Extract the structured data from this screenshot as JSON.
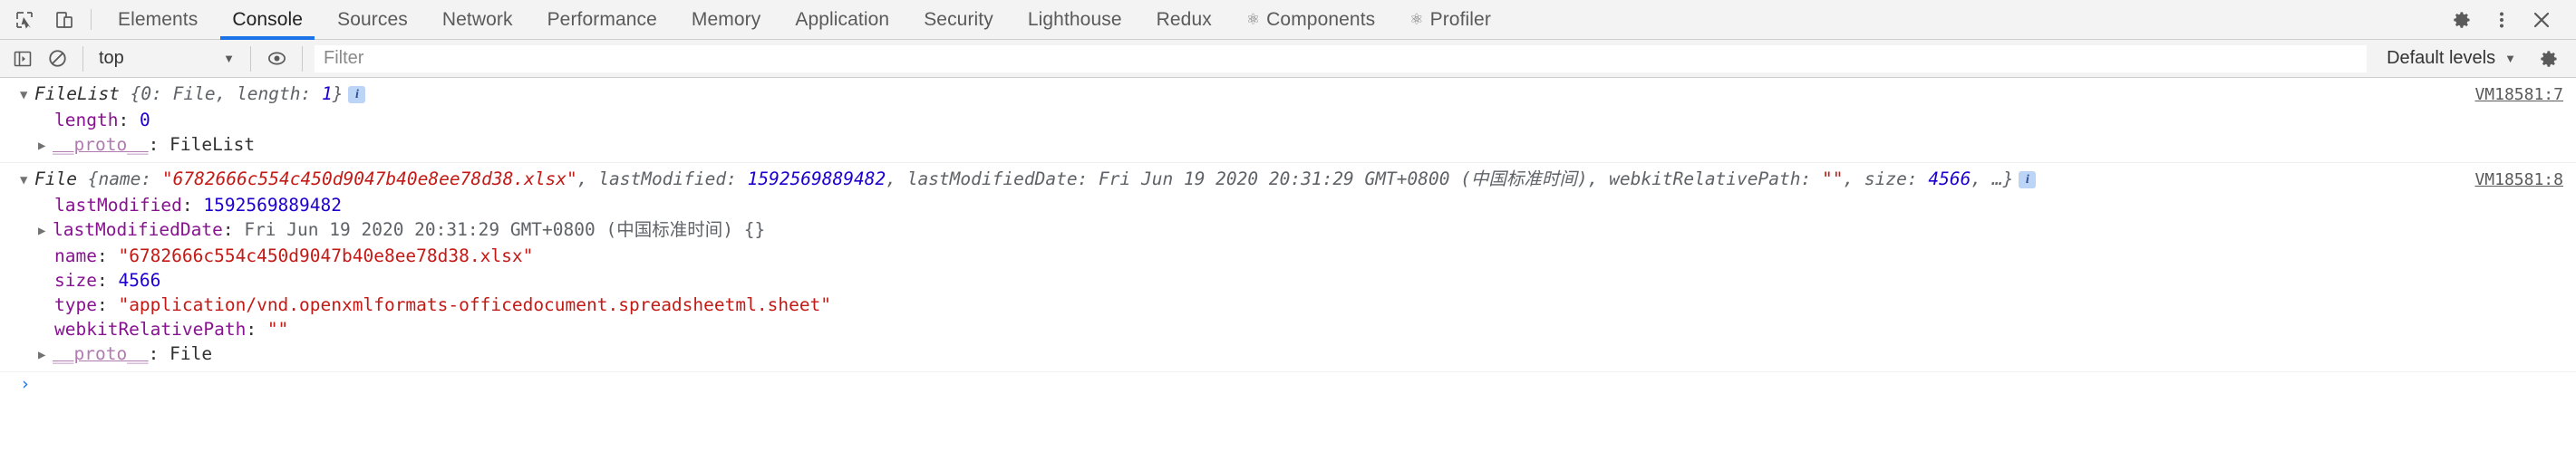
{
  "tabbar": {
    "left_icons": [
      {
        "name": "inspect-element-icon",
        "title": "Inspect element"
      },
      {
        "name": "device-toolbar-icon",
        "title": "Toggle device toolbar"
      }
    ],
    "tabs": [
      {
        "label": "Elements",
        "active": false,
        "icon": ""
      },
      {
        "label": "Console",
        "active": true,
        "icon": ""
      },
      {
        "label": "Sources",
        "active": false,
        "icon": ""
      },
      {
        "label": "Network",
        "active": false,
        "icon": ""
      },
      {
        "label": "Performance",
        "active": false,
        "icon": ""
      },
      {
        "label": "Memory",
        "active": false,
        "icon": ""
      },
      {
        "label": "Application",
        "active": false,
        "icon": ""
      },
      {
        "label": "Security",
        "active": false,
        "icon": ""
      },
      {
        "label": "Lighthouse",
        "active": false,
        "icon": ""
      },
      {
        "label": "Redux",
        "active": false,
        "icon": ""
      },
      {
        "label": "Components",
        "active": false,
        "icon": "⚛"
      },
      {
        "label": "Profiler",
        "active": false,
        "icon": "⚛"
      }
    ],
    "right_icons": [
      {
        "name": "settings-gear-icon"
      },
      {
        "name": "more-options-icon"
      },
      {
        "name": "close-devtools-icon"
      }
    ],
    "accent_color": "#1a73e8"
  },
  "console_toolbar": {
    "sidebar_toggle": "sidebar-toggle-icon",
    "clear_console": "clear-console-icon",
    "context_value": "top",
    "context_caret": "▼",
    "eye_icon": "live-expression-icon",
    "filter_placeholder": "Filter",
    "filter_value": "",
    "levels_label": "Default levels",
    "levels_caret": "▼",
    "settings_icon": "console-settings-icon"
  },
  "console": {
    "messages": [
      {
        "source": "VM18581:7",
        "header": {
          "toggle": "▼",
          "class_name": "FileList",
          "preview": " {0: File, length: 1}",
          "preview_parts": [
            {
              "t": " {0: File, length: ",
              "c": "preview"
            },
            {
              "t": "1",
              "c": "num"
            },
            {
              "t": "}",
              "c": "preview"
            }
          ],
          "info_badge": "i"
        },
        "props": [
          {
            "toggle": "",
            "key": "length",
            "sep": ": ",
            "value": "0",
            "value_class": "num"
          },
          {
            "toggle": "▶",
            "key": "__proto__",
            "sep": ": ",
            "value": "FileList",
            "value_class": "plain"
          }
        ]
      },
      {
        "source": "VM18581:8",
        "header": {
          "toggle": "▼",
          "class_name": "File",
          "preview_parts": [
            {
              "t": " {name: ",
              "c": "preview"
            },
            {
              "t": "\"6782666c554c450d9047b40e8ee78d38.xlsx\"",
              "c": "str"
            },
            {
              "t": ", lastModified: ",
              "c": "preview"
            },
            {
              "t": "1592569889482",
              "c": "num"
            },
            {
              "t": ", lastModifiedDate: Fri Jun 19 2020 20:31:29 GMT+0800 (中国标准时间), webkitRelativePath: ",
              "c": "preview"
            },
            {
              "t": "\"\"",
              "c": "str"
            },
            {
              "t": ", size: ",
              "c": "preview"
            },
            {
              "t": "4566",
              "c": "num"
            },
            {
              "t": ", …}",
              "c": "preview"
            }
          ],
          "info_badge": "i"
        },
        "props": [
          {
            "toggle": "",
            "key": "lastModified",
            "sep": ": ",
            "value": "1592569889482",
            "value_class": "num"
          },
          {
            "toggle": "▶",
            "key": "lastModifiedDate",
            "sep": ": ",
            "value": "Fri Jun 19 2020 20:31:29 GMT+0800 (中国标准时间) {}",
            "value_class": "gray"
          },
          {
            "toggle": "",
            "key": "name",
            "sep": ": ",
            "value": "\"6782666c554c450d9047b40e8ee78d38.xlsx\"",
            "value_class": "str"
          },
          {
            "toggle": "",
            "key": "size",
            "sep": ": ",
            "value": "4566",
            "value_class": "num"
          },
          {
            "toggle": "",
            "key": "type",
            "sep": ": ",
            "value": "\"application/vnd.openxmlformats-officedocument.spreadsheetml.sheet\"",
            "value_class": "str"
          },
          {
            "toggle": "",
            "key": "webkitRelativePath",
            "sep": ": ",
            "value": "\"\"",
            "value_class": "str"
          },
          {
            "toggle": "▶",
            "key": "__proto__",
            "sep": ": ",
            "value": "File",
            "value_class": "plain"
          }
        ]
      }
    ],
    "prompt_caret": "›"
  }
}
